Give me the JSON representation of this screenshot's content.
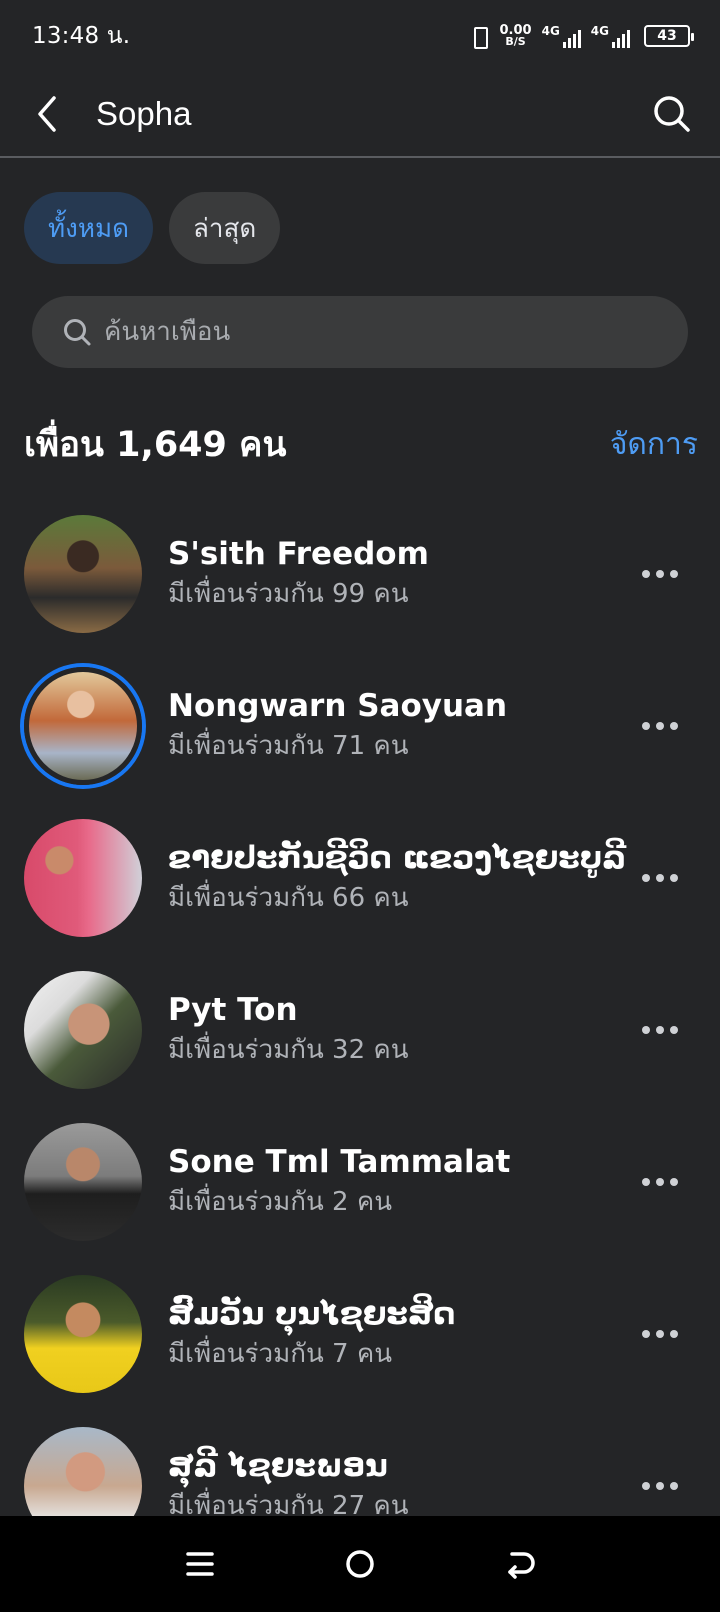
{
  "status_bar": {
    "time": "13:48 น.",
    "speed_value": "0.00",
    "speed_unit": "B/S",
    "network_1": "4G",
    "network_2": "4G",
    "battery": "43"
  },
  "header": {
    "title": "Sopha",
    "back_icon": "chevron-left-icon",
    "search_icon": "search-icon"
  },
  "filters": [
    {
      "label": "ทั้งหมด",
      "active": true
    },
    {
      "label": "ล่าสุด",
      "active": false
    }
  ],
  "search": {
    "placeholder": "ค้นหาเพื่อน",
    "value": ""
  },
  "section": {
    "title": "เพื่อน 1,649 คน",
    "action": "จัดการ"
  },
  "friends": [
    {
      "name": "S'sith Freedom",
      "mutual": "มีเพื่อนร่วมกัน 99 คน",
      "story": false
    },
    {
      "name": "Nongwarn Saoyuan",
      "mutual": "มีเพื่อนร่วมกัน 71 คน",
      "story": true
    },
    {
      "name": "ຂາຍປະກັນຊີວິດ ແຂວງໄຊຍະບູລີ",
      "mutual": "มีเพื่อนร่วมกัน 66 คน",
      "story": false
    },
    {
      "name": "Pyt Ton",
      "mutual": "มีเพื่อนร่วมกัน 32 คน",
      "story": false
    },
    {
      "name": "Sone Tml Tammalat",
      "mutual": "มีเพื่อนร่วมกัน 2 คน",
      "story": false
    },
    {
      "name": "ສົມວັນ ບຸນໄຊຍະສິດ",
      "mutual": "มีเพื่อนร่วมกัน 7 คน",
      "story": false
    },
    {
      "name": "ສຸລີ ໄຊຍະພອນ",
      "mutual": "มีเพื่อนร่วมกัน 27 คน",
      "story": false
    }
  ],
  "colors": {
    "background": "#242527",
    "accent": "#4e9cf4",
    "story_ring": "#1877f2"
  }
}
